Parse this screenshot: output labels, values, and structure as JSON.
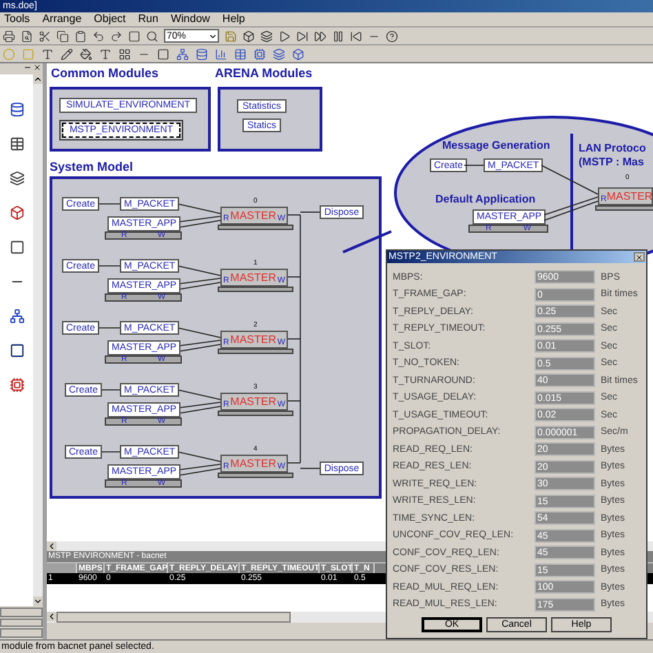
{
  "window": {
    "title": "ms.doe]"
  },
  "menu": [
    "Tools",
    "Arrange",
    "Object",
    "Run",
    "Window",
    "Help"
  ],
  "zoom_combo": {
    "value": "70%"
  },
  "common_modules": {
    "title": "Common Modules",
    "items": [
      {
        "label": "SIMULATE_ENVIRONMENT",
        "selected": false
      },
      {
        "label": "MSTP_ENVIRONMENT",
        "selected": true
      }
    ]
  },
  "arena_modules": {
    "title": "ARENA Modules",
    "items": [
      "Statistics",
      "Statics"
    ]
  },
  "system_model": {
    "title": "System Model",
    "rows": [
      {
        "index": "0",
        "create": "Create",
        "packet": "M_PACKET",
        "app": "MASTER_APP",
        "app_r": "R",
        "app_w": "W",
        "master": "MASTER",
        "master_r": "R",
        "master_w": "W",
        "dispose": "Dispose"
      },
      {
        "index": "1",
        "create": "Create",
        "packet": "M_PACKET",
        "app": "MASTER_APP",
        "app_r": "R",
        "app_w": "W",
        "master": "MASTER",
        "master_r": "R",
        "master_w": "W"
      },
      {
        "index": "2",
        "create": "Create",
        "packet": "M_PACKET",
        "app": "MASTER_APP",
        "app_r": "R",
        "app_w": "W",
        "master": "MASTER",
        "master_r": "R",
        "master_w": "W"
      },
      {
        "index": "3",
        "create": "Create",
        "packet": "M_PACKET",
        "app": "MASTER_APP",
        "app_r": "R",
        "app_w": "W",
        "master": "MASTER",
        "master_r": "R",
        "master_w": "W"
      },
      {
        "index": "4",
        "create": "Create",
        "packet": "M_PACKET",
        "app": "MASTER_APP",
        "app_r": "R",
        "app_w": "W",
        "master": "MASTER",
        "master_r": "R",
        "master_w": "W",
        "dispose": "Dispose"
      }
    ]
  },
  "callout": {
    "message_generation": {
      "title": "Message Generation",
      "create": "Create",
      "packet": "M_PACKET"
    },
    "default_application": {
      "title": "Default Application",
      "app": "MASTER_APP",
      "r": "R",
      "w": "W"
    },
    "lan_protocol": {
      "title": "LAN Protoco",
      "subtitle": "(MSTP : Mas",
      "index": "0",
      "master": "MASTER",
      "r": "R"
    }
  },
  "grid": {
    "title": "MSTP ENVIRONMENT - bacnet",
    "columns": [
      "MBPS",
      "T_FRAME_GAP",
      "T_REPLY_DELAY",
      "T_REPLY_TIMEOUT",
      "T_SLOT",
      "T_N"
    ],
    "rows": [
      {
        "number": "1",
        "cells": [
          "9600",
          "0",
          "0.25",
          "0.255",
          "0.01",
          "0.5"
        ],
        "selected": true
      }
    ]
  },
  "status_bar": {
    "text": "module from bacnet panel selected."
  },
  "dialog": {
    "title": "MSTP2_ENVIRONMENT",
    "fields": [
      {
        "label": "MBPS:",
        "value": "9600",
        "unit": "BPS"
      },
      {
        "label": "T_FRAME_GAP:",
        "value": "0",
        "unit": "Bit times"
      },
      {
        "label": "T_REPLY_DELAY:",
        "value": "0.25",
        "unit": "Sec"
      },
      {
        "label": "T_REPLY_TIMEOUT:",
        "value": "0.255",
        "unit": "Sec"
      },
      {
        "label": "T_SLOT:",
        "value": "0.01",
        "unit": "Sec"
      },
      {
        "label": "T_NO_TOKEN:",
        "value": "0.5",
        "unit": "Sec"
      },
      {
        "label": "T_TURNAROUND:",
        "value": "40",
        "unit": "Bit times"
      },
      {
        "label": "T_USAGE_DELAY:",
        "value": "0.015",
        "unit": "Sec"
      },
      {
        "label": "T_USAGE_TIMEOUT:",
        "value": "0.02",
        "unit": "Sec"
      },
      {
        "label": "PROPAGATION_DELAY:",
        "value": "0.000001",
        "unit": "Sec/m"
      },
      {
        "label": "READ_REQ_LEN:",
        "value": "20",
        "unit": "Bytes"
      },
      {
        "label": "READ_RES_LEN:",
        "value": "20",
        "unit": "Bytes"
      },
      {
        "label": "WRITE_REQ_LEN:",
        "value": "30",
        "unit": "Bytes"
      },
      {
        "label": "WRITE_RES_LEN:",
        "value": "15",
        "unit": "Bytes"
      },
      {
        "label": "TIME_SYNC_LEN:",
        "value": "54",
        "unit": "Bytes"
      },
      {
        "label": "UNCONF_COV_REQ_LEN:",
        "value": "45",
        "unit": "Bytes"
      },
      {
        "label": "CONF_COV_REQ_LEN:",
        "value": "45",
        "unit": "Bytes"
      },
      {
        "label": "CONF_COV_RES_LEN:",
        "value": "15",
        "unit": "Bytes"
      },
      {
        "label": "READ_MUL_REQ_LEN:",
        "value": "100",
        "unit": "Bytes"
      },
      {
        "label": "READ_MUL_RES_LEN:",
        "value": "175",
        "unit": "Bytes"
      }
    ],
    "buttons": [
      "OK",
      "Cancel",
      "Help"
    ]
  }
}
